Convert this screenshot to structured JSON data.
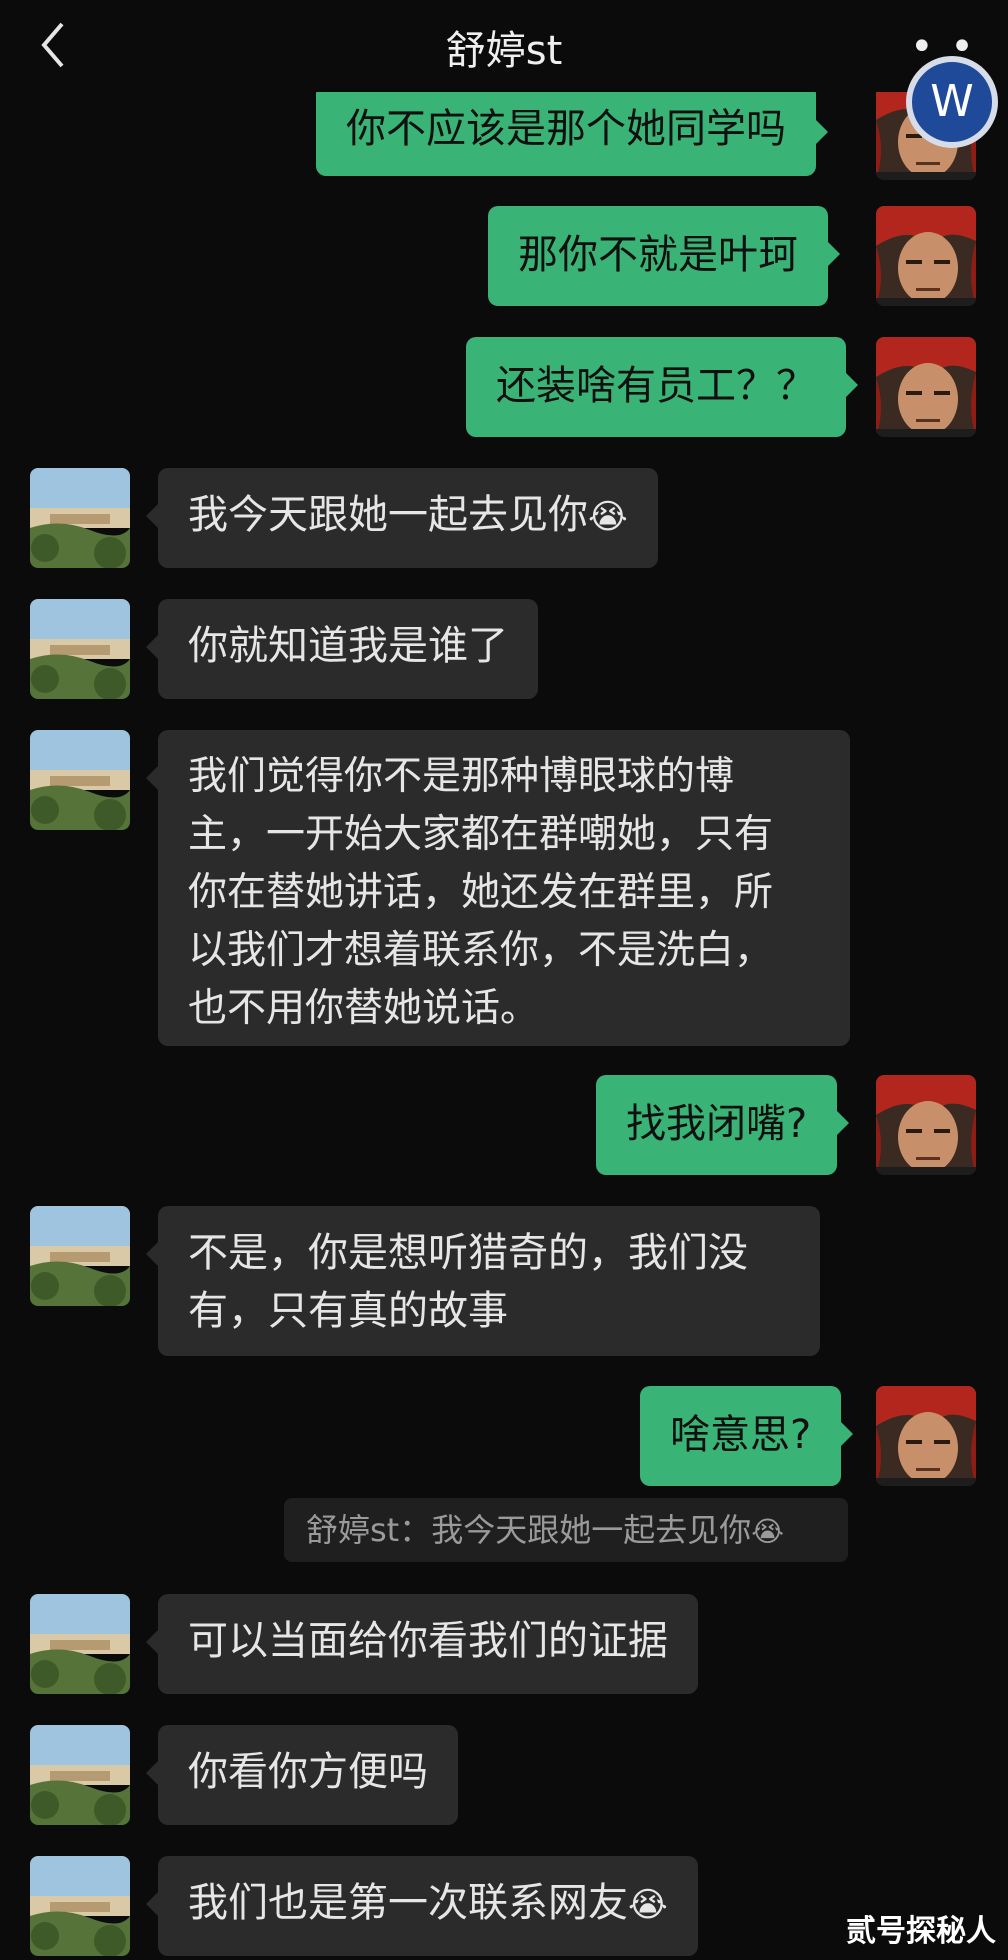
{
  "header": {
    "title": "舒婷st",
    "more": "• • •",
    "badge_letter": "W"
  },
  "messages": [
    {
      "side": "out",
      "text": "你不应该是那个她同学吗"
    },
    {
      "side": "out",
      "text": "那你不就是叶珂"
    },
    {
      "side": "out",
      "text": "还装啥有员工？？"
    },
    {
      "side": "in",
      "text": "我今天跟她一起去见你",
      "emoji": "😭"
    },
    {
      "side": "in",
      "text": "你就知道我是谁了"
    },
    {
      "side": "in",
      "lines": [
        "我们觉得你不是那种博眼球的博",
        "主，一开始大家都在群嘲她，只有",
        "你在替她讲话，她还发在群里，所",
        "以我们才想着联系你，不是洗白，",
        "也不用你替她说话。"
      ]
    },
    {
      "side": "out",
      "text": "找我闭嘴?"
    },
    {
      "side": "in",
      "lines": [
        "不是，你是想听猎奇的，我们没",
        "有，只有真的故事"
      ]
    },
    {
      "side": "out",
      "text": "啥意思?"
    },
    {
      "side": "in",
      "text": "可以当面给你看我们的证据"
    },
    {
      "side": "in",
      "text": "你看你方便吗"
    },
    {
      "side": "in",
      "text": "我们也是第一次联系网友",
      "emoji": "😭"
    }
  ],
  "quote": {
    "text": "舒婷st：我今天跟她一起去见你",
    "emoji": "😭"
  },
  "watermark": "贰号探秘人",
  "colors": {
    "background": "#0b0b0b",
    "incoming_bubble": "#2b2b2b",
    "outgoing_bubble": "#3ab476",
    "badge": "#1f4a9a"
  }
}
